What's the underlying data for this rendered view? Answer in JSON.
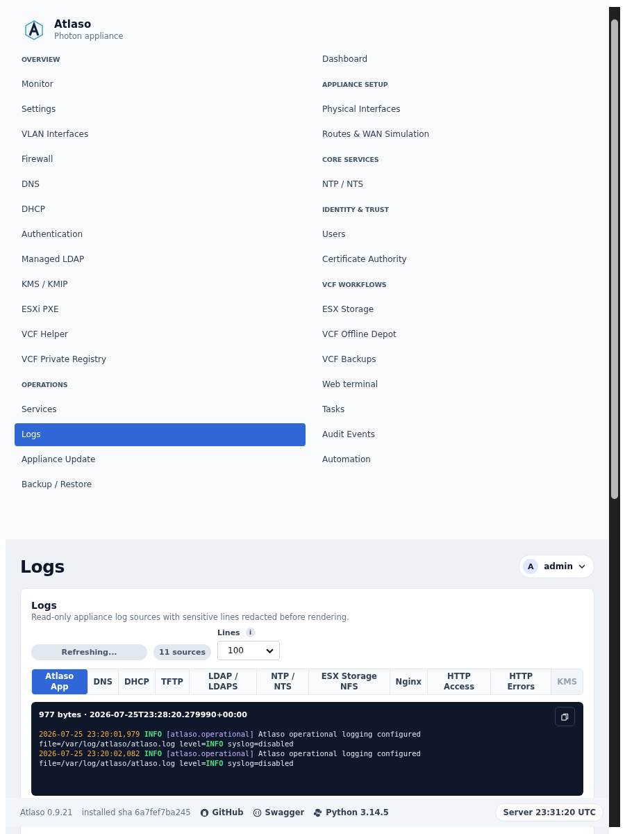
{
  "brand": {
    "name": "Atlaso",
    "subtitle": "Photon appliance"
  },
  "nav": [
    {
      "kind": "heading",
      "label": "OVERVIEW"
    },
    {
      "kind": "item",
      "label": "Dashboard",
      "selected": false
    },
    {
      "kind": "item",
      "label": "Monitor",
      "selected": false
    },
    {
      "kind": "heading",
      "label": "APPLIANCE SETUP"
    },
    {
      "kind": "item",
      "label": "Settings",
      "selected": false
    },
    {
      "kind": "item",
      "label": "Physical Interfaces",
      "selected": false
    },
    {
      "kind": "item",
      "label": "VLAN Interfaces",
      "selected": false
    },
    {
      "kind": "item",
      "label": "Routes & WAN Simulation",
      "selected": false
    },
    {
      "kind": "item",
      "label": "Firewall",
      "selected": false
    },
    {
      "kind": "heading",
      "label": "CORE SERVICES"
    },
    {
      "kind": "item",
      "label": "DNS",
      "selected": false
    },
    {
      "kind": "item",
      "label": "NTP / NTS",
      "selected": false
    },
    {
      "kind": "item",
      "label": "DHCP",
      "selected": false
    },
    {
      "kind": "heading",
      "label": "IDENTITY & TRUST"
    },
    {
      "kind": "item",
      "label": "Authentication",
      "selected": false
    },
    {
      "kind": "item",
      "label": "Users",
      "selected": false
    },
    {
      "kind": "item",
      "label": "Managed LDAP",
      "selected": false
    },
    {
      "kind": "item",
      "label": "Certificate Authority",
      "selected": false
    },
    {
      "kind": "item",
      "label": "KMS / KMIP",
      "selected": false
    },
    {
      "kind": "heading",
      "label": "VCF WORKFLOWS"
    },
    {
      "kind": "item",
      "label": "ESXi PXE",
      "selected": false
    },
    {
      "kind": "item",
      "label": "ESX Storage",
      "selected": false
    },
    {
      "kind": "item",
      "label": "VCF Helper",
      "selected": false
    },
    {
      "kind": "item",
      "label": "VCF Offline Depot",
      "selected": false
    },
    {
      "kind": "item",
      "label": "VCF Private Registry",
      "selected": false
    },
    {
      "kind": "item",
      "label": "VCF Backups",
      "selected": false
    },
    {
      "kind": "heading",
      "label": "OPERATIONS"
    },
    {
      "kind": "item",
      "label": "Web terminal",
      "selected": false
    },
    {
      "kind": "item",
      "label": "Services",
      "selected": false
    },
    {
      "kind": "item",
      "label": "Tasks",
      "selected": false
    },
    {
      "kind": "item",
      "label": "Logs",
      "selected": true
    },
    {
      "kind": "item",
      "label": "Audit Events",
      "selected": false
    },
    {
      "kind": "item",
      "label": "Appliance Update",
      "selected": false
    },
    {
      "kind": "item",
      "label": "Automation",
      "selected": false
    },
    {
      "kind": "item",
      "label": "Backup / Restore",
      "selected": false
    }
  ],
  "page_title": "Logs",
  "user": {
    "initial": "A",
    "name": "admin"
  },
  "card": {
    "title": "Logs",
    "description": "Read-only appliance log sources with sensitive lines redacted before rendering.",
    "refresh_button": "Refreshing...",
    "sources_badge": "11 sources",
    "lines_label": "Lines",
    "lines_info": "i",
    "lines_value": "100",
    "tabs": [
      {
        "label": "Atlaso App",
        "selected": true,
        "disabled": false
      },
      {
        "label": "DNS",
        "selected": false,
        "disabled": false
      },
      {
        "label": "DHCP",
        "selected": false,
        "disabled": false
      },
      {
        "label": "TFTP",
        "selected": false,
        "disabled": false
      },
      {
        "label": "LDAP / LDAPS",
        "selected": false,
        "disabled": false
      },
      {
        "label": "NTP / NTS",
        "selected": false,
        "disabled": false
      },
      {
        "label": "ESX Storage NFS",
        "selected": false,
        "disabled": false
      },
      {
        "label": "Nginx",
        "selected": false,
        "disabled": false
      },
      {
        "label": "HTTP Access",
        "selected": false,
        "disabled": false
      },
      {
        "label": "HTTP Errors",
        "selected": false,
        "disabled": false
      },
      {
        "label": "KMS",
        "selected": false,
        "disabled": true
      }
    ],
    "log": {
      "header": "977 bytes · 2026-07-25T23:28:20.279990+00:00",
      "lines": [
        [
          {
            "kind": "ts",
            "text": "2026-07-25 23:20:01,979"
          },
          {
            "kind": "level",
            "text": "INFO"
          },
          {
            "kind": "logger",
            "text": "[atlaso.operational]"
          },
          {
            "kind": "text",
            "text": "Atlaso operational logging configured"
          }
        ],
        [
          {
            "kind": "text",
            "text": "file=/var/log/atlaso/atlaso.log level="
          },
          {
            "kind": "level",
            "text": "INFO"
          },
          {
            "kind": "text",
            "text": "syslog=disabled"
          }
        ],
        [
          {
            "kind": "ts",
            "text": "2026-07-25 23:20:02,082"
          },
          {
            "kind": "level",
            "text": "INFO"
          },
          {
            "kind": "logger",
            "text": "[atlaso.operational]"
          },
          {
            "kind": "text",
            "text": "Atlaso operational logging configured"
          }
        ],
        [
          {
            "kind": "text",
            "text": "file=/var/log/atlaso/atlaso.log level="
          },
          {
            "kind": "level",
            "text": "INFO"
          },
          {
            "kind": "text",
            "text": "syslog=disabled"
          }
        ]
      ]
    }
  },
  "footer": {
    "version": "Atlaso 0.9.21",
    "sha": "installed sha 6a7fef7ba245",
    "links": [
      {
        "kind": "github",
        "label": "GitHub"
      },
      {
        "kind": "swagger",
        "label": "Swagger"
      },
      {
        "kind": "python",
        "label": "Python 3.14.5"
      }
    ],
    "server_time": "Server 23:31:20 UTC"
  }
}
